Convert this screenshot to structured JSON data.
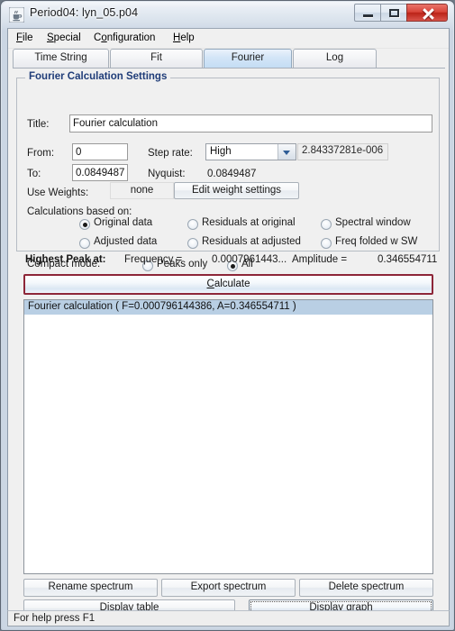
{
  "window": {
    "title": "Period04: lyn_05.p04",
    "icon": "java-coffee-cup-icon",
    "controls": {
      "minimize": "Minimize",
      "maximize": "Maximize",
      "close": "Close"
    }
  },
  "menubar": {
    "items": [
      {
        "label": "File",
        "mnemonic_index": 0
      },
      {
        "label": "Special",
        "mnemonic_index": 0
      },
      {
        "label": "Configuration",
        "mnemonic_index": 1
      },
      {
        "label": "Help",
        "mnemonic_index": 0
      }
    ]
  },
  "tabs": {
    "items": [
      {
        "label": "Time String",
        "selected": false
      },
      {
        "label": "Fit",
        "selected": false
      },
      {
        "label": "Fourier",
        "selected": true
      },
      {
        "label": "Log",
        "selected": false
      }
    ]
  },
  "settings_group": {
    "title": "Fourier Calculation Settings",
    "title_label": "Title:",
    "title_value": "Fourier calculation",
    "from_label": "From:",
    "from_value": "0",
    "to_label": "To:",
    "to_value": "0.0849487",
    "step_rate_label": "Step rate:",
    "step_rate_value": "High",
    "step_rate_options": [
      "High"
    ],
    "step_rate_numeric": "2.84337281e-006",
    "nyquist_label": "Nyquist:",
    "nyquist_value": "0.0849487",
    "use_weights_label": "Use Weights:",
    "use_weights_value": "none",
    "edit_weight_button": "Edit weight settings",
    "calculations_based_on_label": "Calculations based on:",
    "basis_options": [
      {
        "label": "Original data",
        "selected": true
      },
      {
        "label": "Residuals at original",
        "selected": false
      },
      {
        "label": "Spectral window",
        "selected": false
      },
      {
        "label": "Adjusted data",
        "selected": false
      },
      {
        "label": "Residuals at adjusted",
        "selected": false
      },
      {
        "label": "Freq folded w SW",
        "selected": false
      }
    ],
    "compact_mode_label": "Compact mode:",
    "compact_options": [
      {
        "label": "Peaks only",
        "selected": false
      },
      {
        "label": "All",
        "selected": true
      }
    ]
  },
  "peak_info": {
    "label": "Highest Peak at:",
    "frequency_label": "Frequency =",
    "frequency_value": "0.0007961443...",
    "amplitude_label": "Amplitude =",
    "amplitude_value": "0.346554711"
  },
  "calculate_button": {
    "label": "Calculate",
    "mnemonic": "C",
    "border_color": "#8d2638"
  },
  "spectrum_list": {
    "items": [
      {
        "text": "Fourier calculation ( F=0.000796144386, A=0.346554711 )",
        "selected": true
      }
    ]
  },
  "bottom_buttons": {
    "rename": "Rename spectrum",
    "export": "Export spectrum",
    "delete": "Delete spectrum",
    "display_table": "Display table",
    "display_graph": "Display graph",
    "display_graph_mnemonic": "D"
  },
  "statusbar": {
    "text": "For help press F1"
  },
  "colors": {
    "group_title": "#1f3c78",
    "selection": "#b9cfe4",
    "accent_red": "#8d2638",
    "tab_selected": "#c4ddf4"
  }
}
